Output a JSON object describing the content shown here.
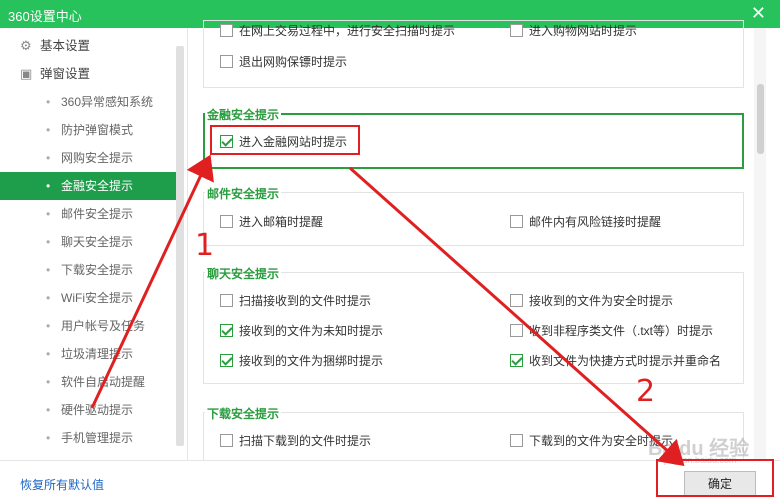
{
  "window": {
    "title": "360设置中心",
    "close": "✕"
  },
  "sidebar": {
    "groups": [
      {
        "label": "基本设置",
        "icon": "gear-icon"
      },
      {
        "label": "弹窗设置",
        "icon": "window-icon"
      }
    ],
    "items": [
      "360异常感知系统",
      "防护弹窗模式",
      "网购安全提示",
      "金融安全提示",
      "邮件安全提示",
      "聊天安全提示",
      "下载安全提示",
      "WiFi安全提示",
      "用户帐号及任务",
      "垃圾清理提示",
      "软件自启动提醒",
      "硬件驱动提示",
      "手机管理提示"
    ],
    "active_item": "金融安全提示"
  },
  "shopping": {
    "opt1": "在网上交易过程中，进行安全扫描时提示",
    "opt2": "进入购物网站时提示",
    "opt3": "退出网购保镖时提示"
  },
  "finance": {
    "title": "金融安全提示",
    "opt1": "进入金融网站时提示",
    "opt1_checked": true
  },
  "mail": {
    "title": "邮件安全提示",
    "opt1": "进入邮箱时提醒",
    "opt2": "邮件内有风险链接时提醒"
  },
  "chat": {
    "title": "聊天安全提示",
    "opt1": "扫描接收到的文件时提示",
    "opt2": "接收到的文件为安全时提示",
    "opt3": "接收到的文件为未知时提示",
    "opt4": "收到非程序类文件（.txt等）时提示",
    "opt5": "接收到的文件为捆绑时提示",
    "opt6": "收到文件为快捷方式时提示并重命名",
    "checked": {
      "opt1": false,
      "opt2": false,
      "opt3": true,
      "opt4": false,
      "opt5": true,
      "opt6": true
    }
  },
  "download": {
    "title": "下载安全提示",
    "opt1": "扫描下载到的文件时提示",
    "opt2": "下载到的文件为安全时提示"
  },
  "footer": {
    "restore": "恢复所有默认值",
    "ok": "确定"
  },
  "annotations": {
    "num1": "1",
    "num2": "2",
    "color": "#e02020"
  },
  "watermark": {
    "text": "Baidu 经验",
    "url": "jingyan.baidu.com"
  },
  "colors": {
    "titlebar": "#27c25b",
    "active": "#1e9e4b",
    "accent": "#2a9d3f",
    "link": "#1a66c4"
  }
}
